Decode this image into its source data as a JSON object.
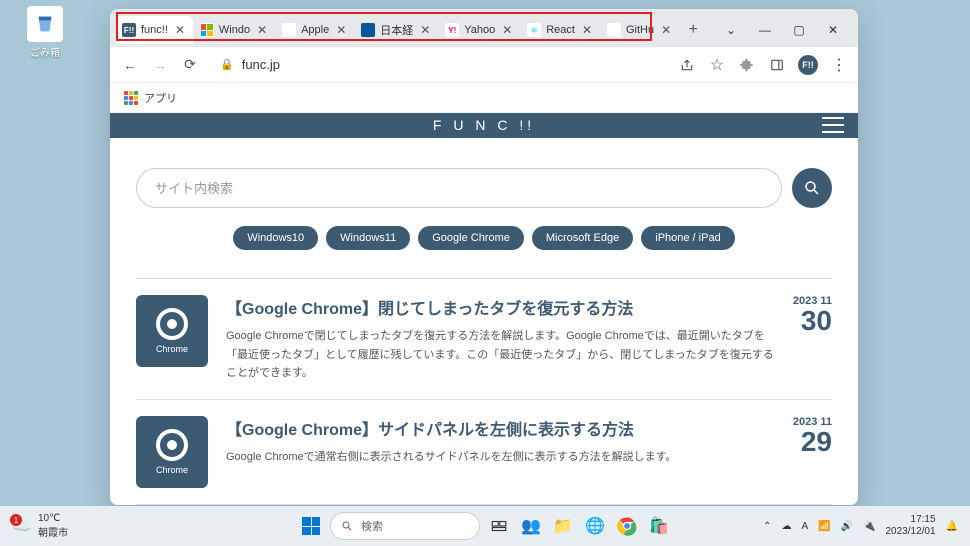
{
  "desktop": {
    "recycle_bin": "ごみ箱"
  },
  "tabs": [
    {
      "title": "func!!",
      "favicon_bg": "#3d5a73",
      "favicon_text": "F!!",
      "favicon_color": "#fff"
    },
    {
      "title": "Windo",
      "favicon_bg": "#fff",
      "favicon_svg": "ms"
    },
    {
      "title": "Apple",
      "favicon_bg": "#fff",
      "favicon_text": "",
      "favicon_color": "#000"
    },
    {
      "title": "日本経",
      "favicon_bg": "#00579d",
      "favicon_text": "",
      "favicon_color": "#fff"
    },
    {
      "title": "Yahoo",
      "favicon_bg": "#fff",
      "favicon_text": "Y!",
      "favicon_color": "#ff0033"
    },
    {
      "title": "React",
      "favicon_bg": "#fff",
      "favicon_text": "⚛",
      "favicon_color": "#61dafb"
    },
    {
      "title": "GitHu",
      "favicon_bg": "#fff",
      "favicon_text": "",
      "favicon_color": "#000"
    }
  ],
  "address": {
    "url": "func.jp"
  },
  "bookmarks": {
    "apps": "アプリ"
  },
  "page": {
    "brand": "F U N C !!",
    "search_placeholder": "サイト内検索",
    "tags": [
      "Windows10",
      "Windows11",
      "Google Chrome",
      "Microsoft Edge",
      "iPhone / iPad"
    ]
  },
  "articles": [
    {
      "icon_caption": "Chrome",
      "title": "【Google Chrome】閉じてしまったタブを復元する方法",
      "desc": "Google Chromeで閉じてしまったタブを復元する方法を解説します。Google Chromeでは、最近開いたタブを「最近使ったタブ」として履歴に残しています。この「最近使ったタブ」から、閉じてしまったタブを復元することができます。",
      "ym": "2023 11",
      "day": "30"
    },
    {
      "icon_caption": "Chrome",
      "title": "【Google Chrome】サイドパネルを左側に表示する方法",
      "desc": "Google Chromeで通常右側に表示されるサイドパネルを左側に表示する方法を解説します。",
      "ym": "2023 11",
      "day": "29"
    }
  ],
  "taskbar": {
    "temp": "10℃",
    "city": "朝霞市",
    "search": "検索",
    "lang": "A",
    "time": "17:15",
    "date": "2023/12/01",
    "badge": "1"
  }
}
